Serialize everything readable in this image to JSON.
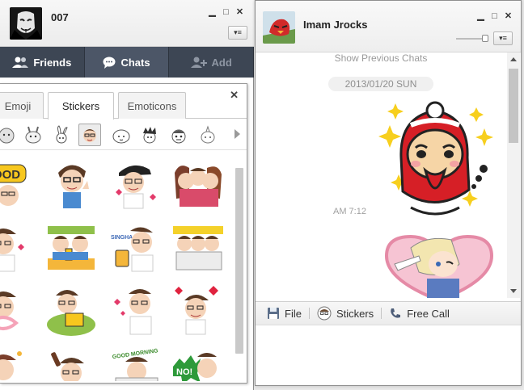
{
  "main_window": {
    "title": "007",
    "controls": [
      "▁",
      "□",
      "✕"
    ],
    "tabs": [
      {
        "label": "Friends",
        "icon": "friends-icon",
        "active": false
      },
      {
        "label": "Chats",
        "icon": "chat-bubble-icon",
        "active": true
      },
      {
        "label": "Add",
        "icon": "add-friend-icon",
        "active": false
      }
    ]
  },
  "sticker_panel": {
    "tabs": [
      "Emoji",
      "Stickers",
      "Emoticons"
    ],
    "active_tab": "Stickers",
    "close": "✕",
    "packs": [
      "moon-pack-icon",
      "bunny-pack-icon",
      "rabbit-pack-icon",
      "guy-pack-icon",
      "bald-pack-icon",
      "spiky-pack-icon",
      "head-pack-icon",
      "sketch-pack-icon"
    ],
    "grid_texts": {
      "good": "OOD",
      "singha": "SINGHA",
      "nope": "NO!",
      "banner": "GOOD MORNING"
    }
  },
  "chat_window": {
    "title": "Imam Jrocks",
    "controls": [
      "▁",
      "□",
      "✕"
    ],
    "show_previous": "Show Previous Chats",
    "date": "2013/01/20 SUN",
    "time": "AM 7:12",
    "toolbar": {
      "file": "File",
      "stickers": "Stickers",
      "free_call": "Free Call"
    }
  },
  "colors": {
    "nav_bg": "#3d4654",
    "nav_active": "#4c5667",
    "sticker_red": "#d61f26"
  }
}
